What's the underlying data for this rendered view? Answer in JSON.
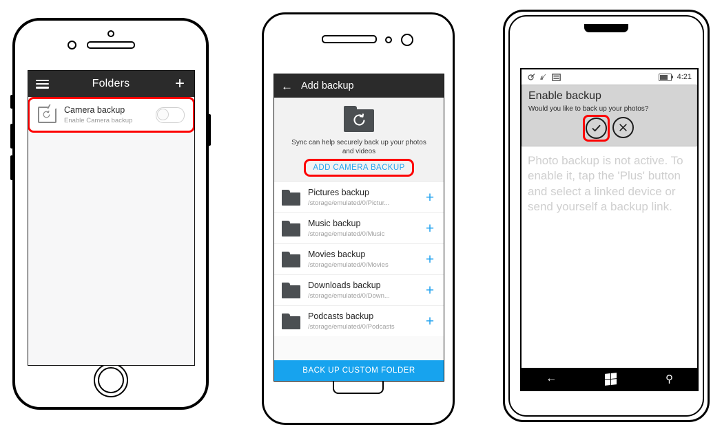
{
  "phones": {
    "ios": {
      "device": "iphone-frame",
      "screen": {
        "appbar": {
          "menu_icon": "hamburger-icon",
          "title": "Folders",
          "add_icon": "plus-icon"
        },
        "rows": [
          {
            "icon": "folder-sync-icon",
            "title": "Camera backup",
            "subtitle": "Enable Camera backup",
            "toggle_state": "off",
            "highlighted": true
          }
        ]
      }
    },
    "android": {
      "device": "android-frame",
      "screen": {
        "appbar": {
          "back_icon": "back-arrow-icon",
          "title": "Add backup"
        },
        "hero": {
          "icon": "folder-sync-filled-icon",
          "text": "Sync can help securely back up your photos and videos",
          "cta_label": "ADD CAMERA BACKUP",
          "cta_highlighted": true,
          "cta_color": "#23a3ef"
        },
        "folders": [
          {
            "name": "Pictures backup",
            "path": "/storage/emulated/0/Pictur...",
            "action_icon": "plus-icon"
          },
          {
            "name": "Music backup",
            "path": "/storage/emulated/0/Music",
            "action_icon": "plus-icon"
          },
          {
            "name": "Movies backup",
            "path": "/storage/emulated/0/Movies",
            "action_icon": "plus-icon"
          },
          {
            "name": "Downloads backup",
            "path": "/storage/emulated/0/Down...",
            "action_icon": "plus-icon"
          },
          {
            "name": "Podcasts backup",
            "path": "/storage/emulated/0/Podcasts",
            "action_icon": "plus-icon"
          }
        ],
        "bottom_cta": {
          "label": "BACK UP CUSTOM FOLDER",
          "color": "#17a3ee"
        }
      }
    },
    "windows": {
      "device": "windows-phone-frame",
      "screen": {
        "status_bar": {
          "icons": [
            "roaming-icon",
            "signal-icon",
            "sim-card-icon"
          ],
          "battery_icon": "battery-icon",
          "time": "4:21"
        },
        "dialog": {
          "title": "Enable backup",
          "message": "Would you like to back up your photos?",
          "accept_icon": "check-circle-icon",
          "decline_icon": "close-circle-icon",
          "accept_highlighted": true
        },
        "body_text": "Photo backup is not active. To enable it, tap the 'Plus' button and select a linked device or send yourself a backup link.",
        "nav_bar": {
          "back_icon": "back-arrow-icon",
          "start_icon": "windows-logo-icon",
          "search_icon": "search-icon"
        }
      }
    }
  },
  "accents": {
    "highlight": "#fd0202",
    "blue": "#17a3ee",
    "appbar": "#2b2b2b"
  }
}
